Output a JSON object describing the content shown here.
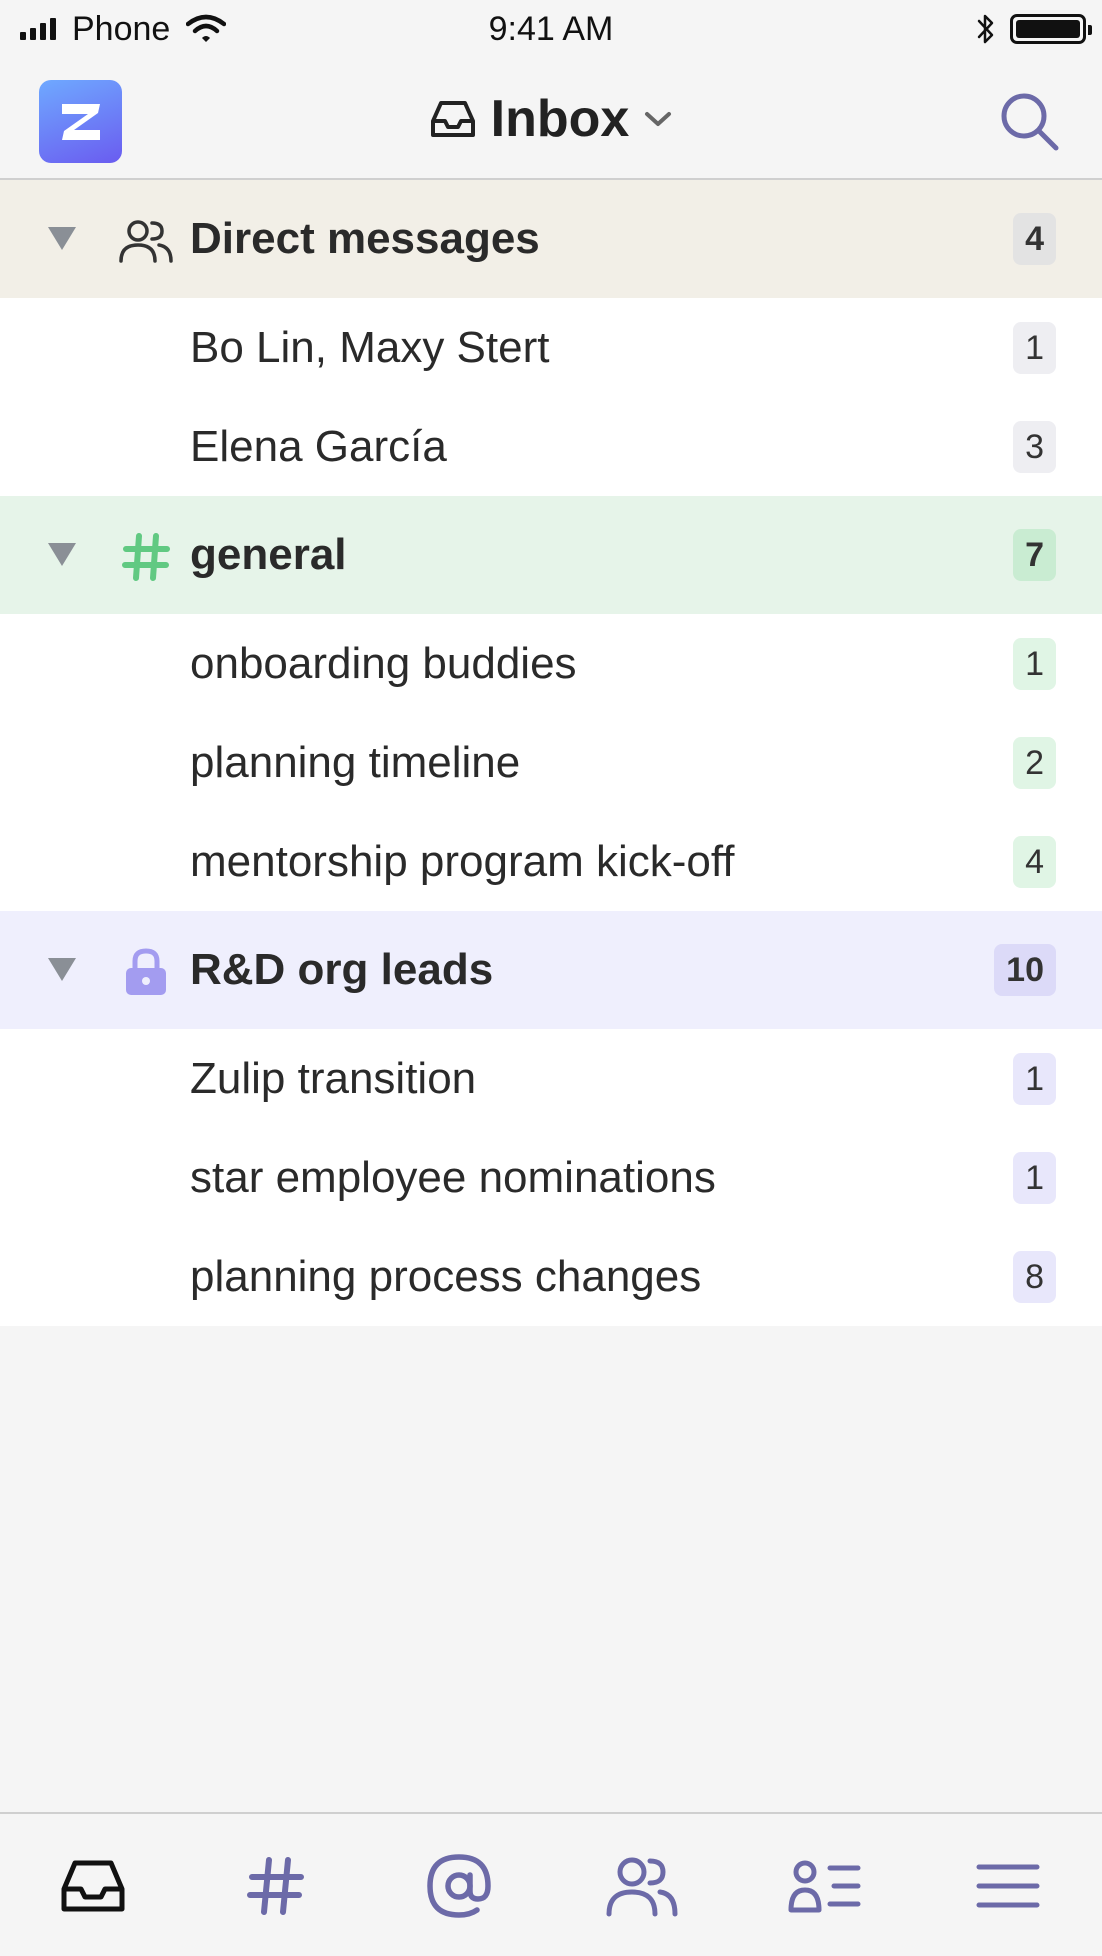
{
  "status_bar": {
    "carrier": "Phone",
    "time": "9:41 AM"
  },
  "header": {
    "title": "Inbox",
    "logo_letter": "Z"
  },
  "colors": {
    "accent": "#6c6aa8",
    "brand_gradient_start": "#6fa9ff",
    "brand_gradient_end": "#6a5cf0",
    "general_stream": "#61c982",
    "private_stream": "#a39cf0"
  },
  "groups": [
    {
      "icon": "people-icon",
      "label": "Direct messages",
      "count": "4",
      "items": [
        {
          "label": "Bo Lin, Maxy Stert",
          "count": "1"
        },
        {
          "label": "Elena García",
          "count": "3"
        }
      ]
    },
    {
      "icon": "hash-icon",
      "label": "general",
      "count": "7",
      "items": [
        {
          "label": "onboarding buddies",
          "count": "1"
        },
        {
          "label": "planning timeline",
          "count": "2"
        },
        {
          "label": "mentorship program kick-off",
          "count": "4"
        }
      ]
    },
    {
      "icon": "lock-icon",
      "label": "R&D org leads",
      "count": "10",
      "items": [
        {
          "label": "Zulip transition",
          "count": "1"
        },
        {
          "label": "star employee nominations",
          "count": "1"
        },
        {
          "label": "planning process changes",
          "count": "8"
        }
      ]
    }
  ],
  "tab_bar": {
    "tabs": [
      {
        "icon": "inbox-icon",
        "selected": true
      },
      {
        "icon": "hash-icon",
        "selected": false
      },
      {
        "icon": "at-mention-icon",
        "selected": false
      },
      {
        "icon": "people-icon",
        "selected": false
      },
      {
        "icon": "user-list-icon",
        "selected": false
      },
      {
        "icon": "menu-icon",
        "selected": false
      }
    ]
  }
}
